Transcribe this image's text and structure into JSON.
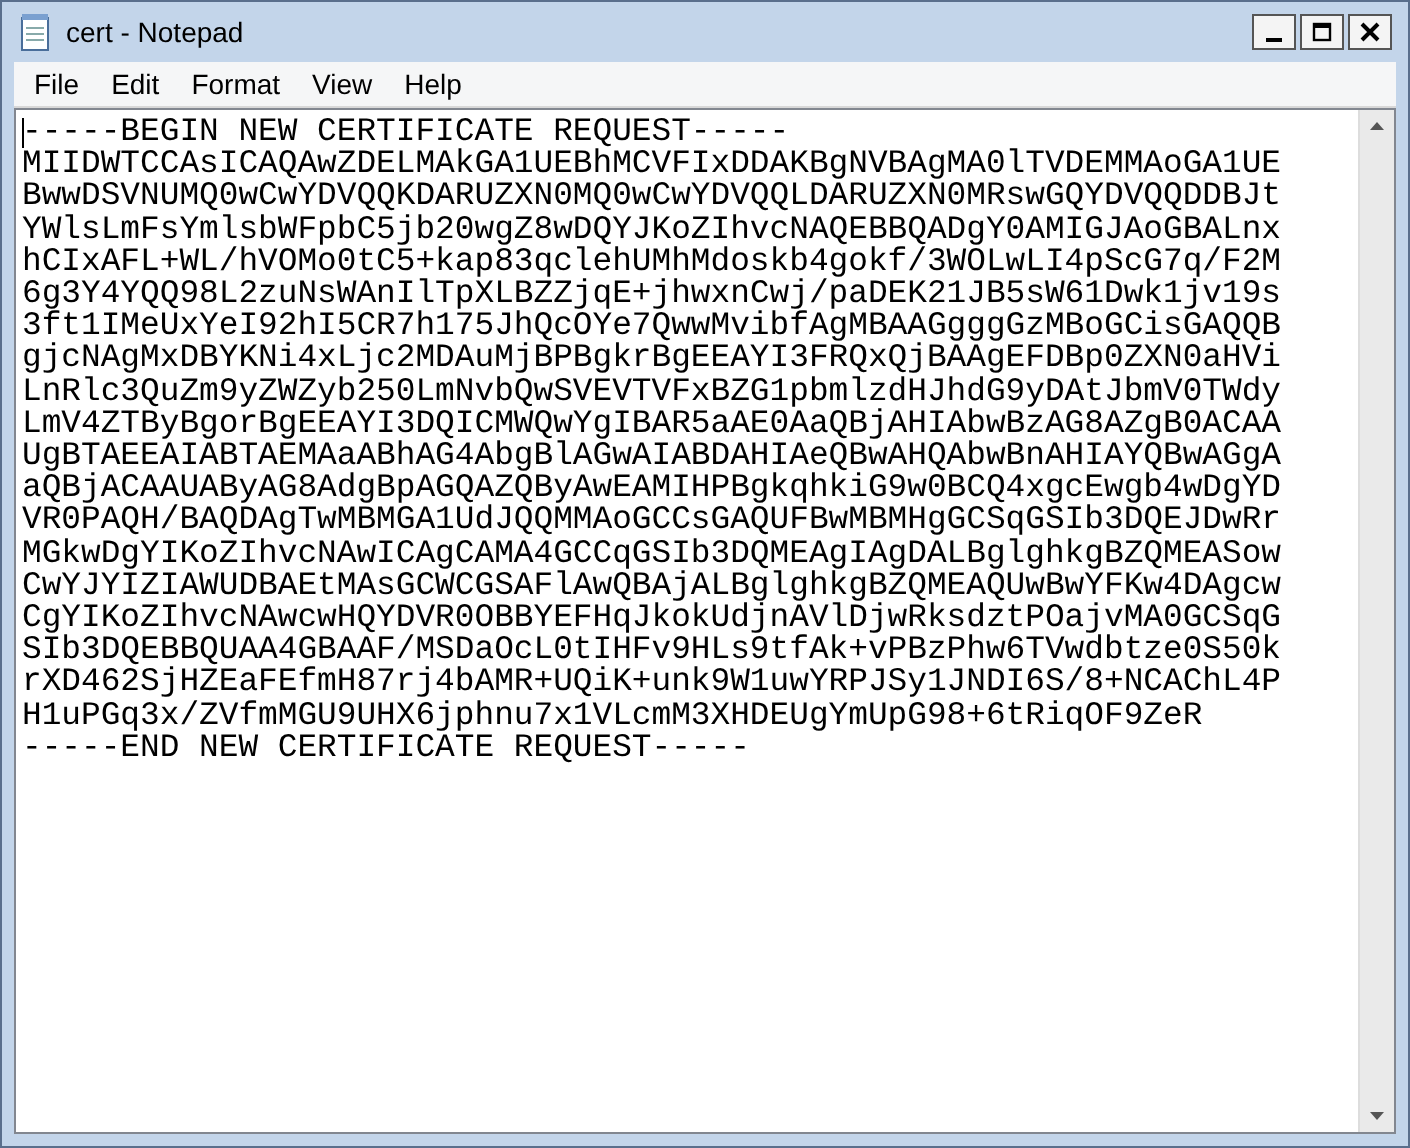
{
  "window": {
    "title": "cert - Notepad"
  },
  "menu": [
    "File",
    "Edit",
    "Format",
    "View",
    "Help"
  ],
  "editor": {
    "lines": [
      "-----BEGIN NEW CERTIFICATE REQUEST-----",
      "MIIDWTCCAsICAQAwZDELMAkGA1UEBhMCVFIxDDAKBgNVBAgMA0lTVDEMMAoGA1UE",
      "BwwDSVNUMQ0wCwYDVQQKDARUZXN0MQ0wCwYDVQQLDARUZXN0MRswGQYDVQQDDBJt",
      "YWlsLmFsYmlsbWFpbC5jb20wgZ8wDQYJKoZIhvcNAQEBBQADgY0AMIGJAoGBALnx",
      "hCIxAFL+WL/hVOMo0tC5+kap83qclehUMhMdoskb4gokf/3WOLwLI4pScG7q/F2M",
      "6g3Y4YQQ98L2zuNsWAnIlTpXLBZZjqE+jhwxnCwj/paDEK21JB5sW61Dwk1jv19s",
      "3ft1IMeUxYeI92hI5CR7h175JhQcOYe7QwwMvibfAgMBAAGgggGzMBoGCisGAQQB",
      "gjcNAgMxDBYKNi4xLjc2MDAuMjBPBgkrBgEEAYI3FRQxQjBAAgEFDBp0ZXN0aHVi",
      "LnRlc3QuZm9yZWZyb250LmNvbQwSVEVTVFxBZG1pbmlzdHJhdG9yDAtJbmV0TWdy",
      "LmV4ZTByBgorBgEEAYI3DQICMWQwYgIBAR5aAE0AaQBjAHIAbwBzAG8AZgB0ACAA",
      "UgBTAEEAIABTAEMAaABhAG4AbgBlAGwAIABDAHIAeQBwAHQAbwBnAHIAYQBwAGgA",
      "aQBjACAAUAByAG8AdgBpAGQAZQByAwEAMIHPBgkqhkiG9w0BCQ4xgcEwgb4wDgYD",
      "VR0PAQH/BAQDAgTwMBMGA1UdJQQMMAoGCCsGAQUFBwMBMHgGCSqGSIb3DQEJDwRr",
      "MGkwDgYIKoZIhvcNAwICAgCAMA4GCCqGSIb3DQMEAgIAgDALBglghkgBZQMEASow",
      "CwYJYIZIAWUDBAEtMAsGCWCGSAFlAwQBAjALBglghkgBZQMEAQUwBwYFKw4DAgcw",
      "CgYIKoZIhvcNAwcwHQYDVR0OBBYEFHqJkokUdjnAVlDjwRksdztPOajvMA0GCSqG",
      "SIb3DQEBBQUAA4GBAAF/MSDaOcL0tIHFv9HLs9tfAk+vPBzPhw6TVwdbtze0S50k",
      "rXD462SjHZEaFEfmH87rj4bAMR+UQiK+unk9W1uwYRPJSy1JNDI6S/8+NCAChL4P",
      "H1uPGq3x/ZVfmMGU9UHX6jphnu7x1VLcmM3XHDEUgYmUpG98+6tRiqOF9ZeR",
      "-----END NEW CERTIFICATE REQUEST-----"
    ]
  }
}
